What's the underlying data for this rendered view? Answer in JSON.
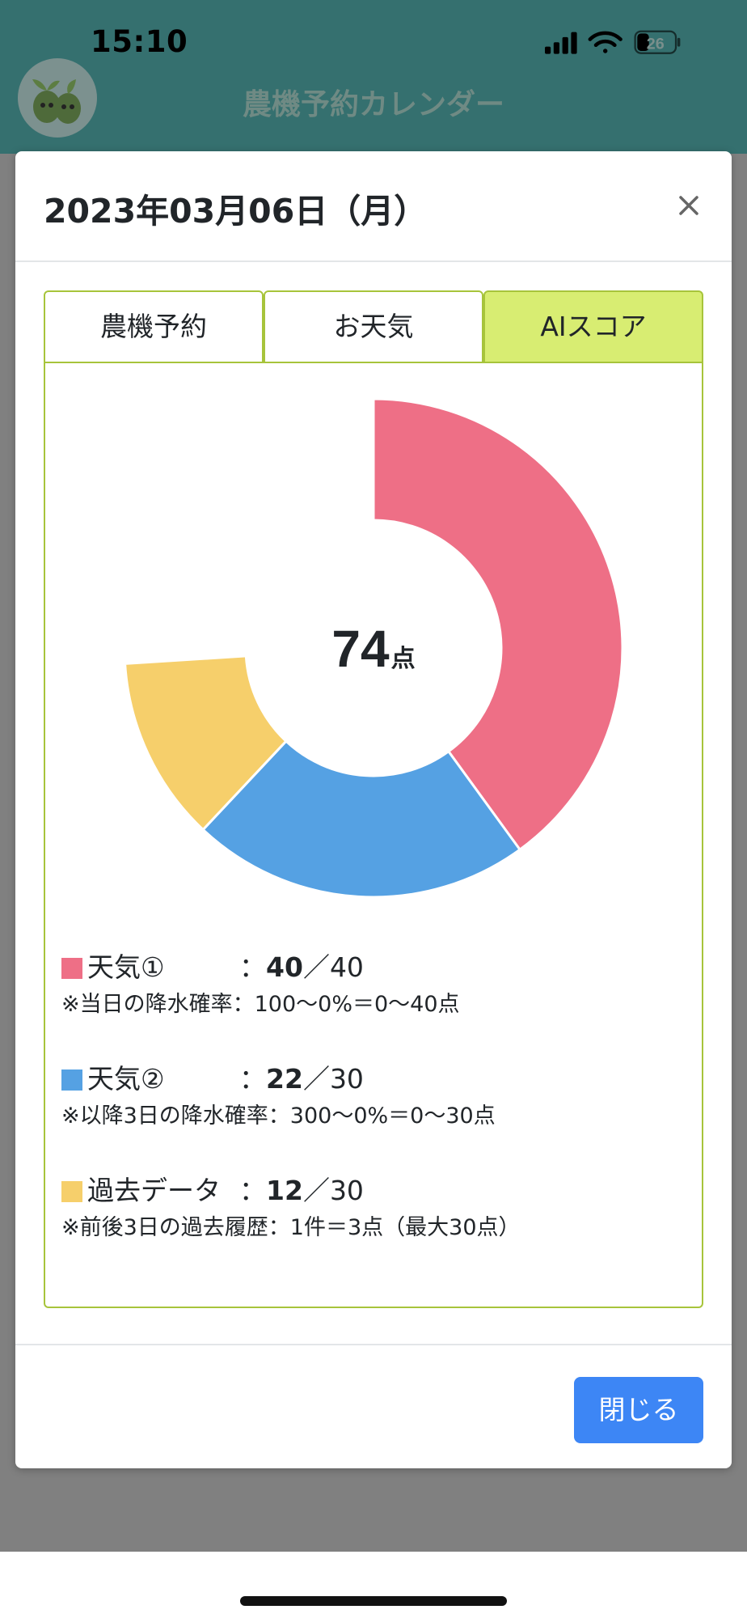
{
  "status_bar": {
    "time": "15:10",
    "battery": "26"
  },
  "app": {
    "title": "農機予約カレンダー"
  },
  "modal": {
    "title": "2023年03月06日（月）",
    "close_symbol": "×",
    "tabs": [
      {
        "label": "農機予約",
        "active": false
      },
      {
        "label": "お天気",
        "active": false
      },
      {
        "label": "AIスコア",
        "active": true
      }
    ],
    "score": {
      "value": "74",
      "unit": "点"
    },
    "legend": [
      {
        "label": "天気①",
        "sep": "：",
        "score": "40",
        "max": "／40",
        "color": "#ee6f86",
        "note": "※当日の降水確率：100〜0%＝0〜40点"
      },
      {
        "label": "天気②",
        "sep": "：",
        "score": "22",
        "max": "／30",
        "color": "#55a1e3",
        "note": "※以降3日の降水確率：300〜0%＝0〜30点"
      },
      {
        "label": "過去データ",
        "sep": "：",
        "score": "12",
        "max": "／30",
        "color": "#f6cf6b",
        "note": "※前後3日の過去履歴：1件＝3点（最大30点）"
      }
    ],
    "close_button": "閉じる"
  },
  "chart_data": {
    "type": "pie",
    "variant": "donut",
    "total_max": 100,
    "center_label": "74点",
    "series": [
      {
        "name": "天気①",
        "value": 40,
        "color": "#ee6f86"
      },
      {
        "name": "天気②",
        "value": 22,
        "color": "#55a1e3"
      },
      {
        "name": "過去データ",
        "value": 12,
        "color": "#f6cf6b"
      }
    ]
  }
}
